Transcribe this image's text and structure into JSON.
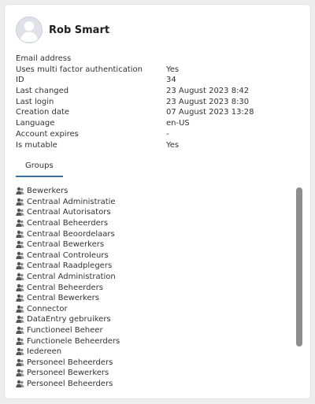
{
  "user": {
    "name": "Rob Smart"
  },
  "properties": [
    {
      "key": "Email address",
      "value": ""
    },
    {
      "key": "Uses multi factor authentication",
      "value": "Yes"
    },
    {
      "key": "ID",
      "value": "34"
    },
    {
      "key": "Last changed",
      "value": "23 August 2023 8:42"
    },
    {
      "key": "Last login",
      "value": "23 August 2023 8:30"
    },
    {
      "key": "Creation date",
      "value": "07 August 2023 13:28"
    },
    {
      "key": "Language",
      "value": "en-US"
    },
    {
      "key": "Account expires",
      "value": "-"
    },
    {
      "key": "Is mutable",
      "value": "Yes"
    }
  ],
  "tabs": [
    {
      "label": "Groups",
      "active": true
    }
  ],
  "groups": [
    "Bewerkers",
    "Centraal Administratie",
    "Centraal Autorisators",
    "Centraal Beheerders",
    "Centraal Beoordelaars",
    "Centraal Bewerkers",
    "Centraal Controleurs",
    "Centraal Raadplegers",
    "Central Administration",
    "Central Beheerders",
    "Central Bewerkers",
    "Connector",
    "DataEntry gebruikers",
    "Functioneel Beheer",
    "Functionele Beheerders",
    "Iedereen",
    "Personeel Beheerders",
    "Personeel Bewerkers",
    "Personeel Beheerders"
  ],
  "icons": {
    "avatar": "user-avatar-icon",
    "group": "group-users-icon"
  },
  "colors": {
    "accent": "#3f6fa8",
    "scrollbar": "#8e8e8e"
  }
}
